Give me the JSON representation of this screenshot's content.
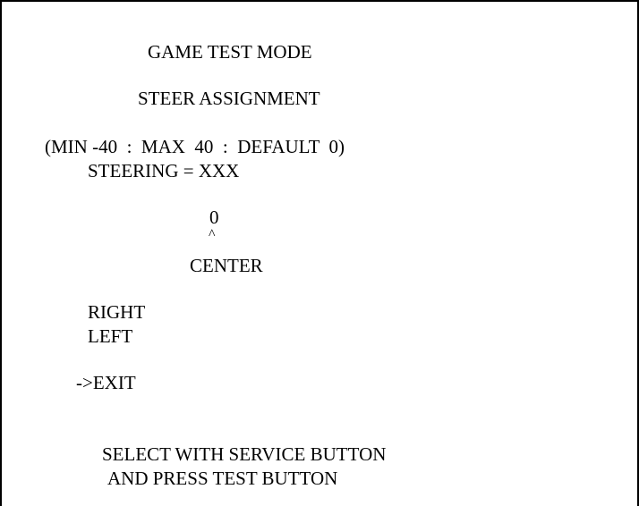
{
  "header": {
    "title": "GAME TEST MODE",
    "subtitle": "STEER ASSIGNMENT"
  },
  "range": {
    "text": "(MIN -40  :  MAX  40  :  DEFAULT  0)"
  },
  "steering": {
    "readout": "STEERING = XXX"
  },
  "center": {
    "value": "0",
    "caret": "^",
    "label": "CENTER"
  },
  "menu": {
    "items": [
      {
        "label": "RIGHT"
      },
      {
        "label": "LEFT"
      },
      {
        "label": "->EXIT"
      }
    ]
  },
  "footer": {
    "line1": "SELECT WITH SERVICE BUTTON",
    "line2": "AND PRESS TEST BUTTON"
  },
  "colors": {
    "background": "#ffffff",
    "text": "#000000"
  }
}
